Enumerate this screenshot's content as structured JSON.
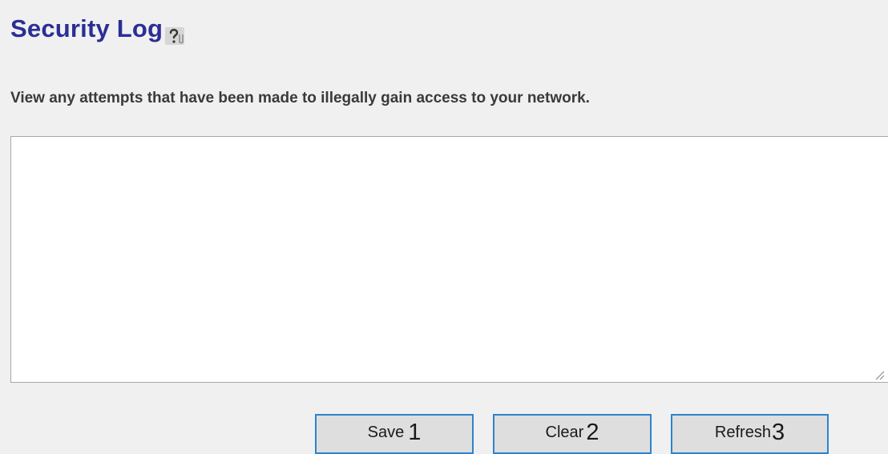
{
  "header": {
    "title": "Security Log",
    "help_icon": "help-icon"
  },
  "description": "View any attempts that have been made to illegally gain access to your network.",
  "log": {
    "value": ""
  },
  "buttons": [
    {
      "label": "Save",
      "number": "1"
    },
    {
      "label": "Clear",
      "number": "2"
    },
    {
      "label": "Refresh",
      "number": "3"
    }
  ],
  "colors": {
    "title": "#2b2e94",
    "background": "#f0f0f0",
    "button_border": "#2e83cd",
    "button_fill": "#dedede"
  }
}
